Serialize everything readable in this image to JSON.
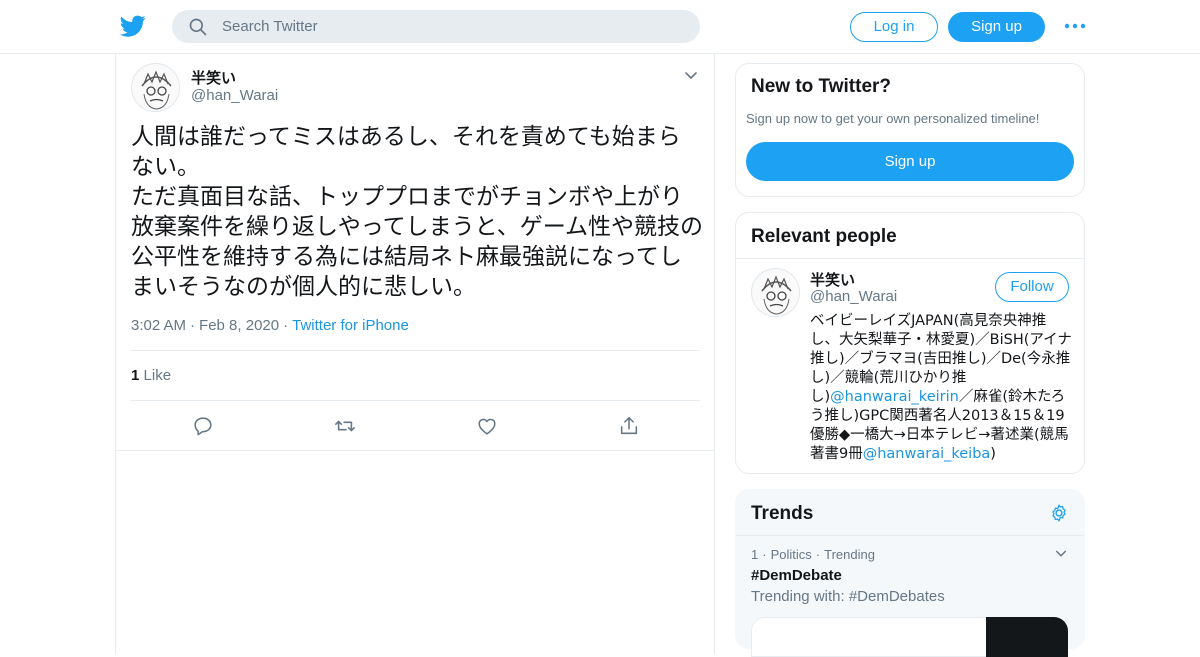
{
  "header": {
    "search_placeholder": "Search Twitter",
    "login_label": "Log in",
    "signup_label": "Sign up",
    "brand_color": "#1da1f2"
  },
  "tweet": {
    "display_name": "半笑い",
    "handle": "@han_Warai",
    "text": "人間は誰だってミスはあるし、それを責めても始まらない。\nただ真面目な話、トッププロまでがチョンボや上がり放棄案件を繰り返しやってしまうと、ゲーム性や競技の公平性を維持する為には結局ネト麻最強説になってしまいそうなのが個人的に悲しい。",
    "time": "3:02 AM",
    "date": "Feb 8, 2020",
    "source": "Twitter for iPhone",
    "like_count": "1",
    "like_label": "Like",
    "actions": [
      "reply-icon",
      "retweet-icon",
      "like-icon",
      "share-icon"
    ]
  },
  "sidebar": {
    "signup_card": {
      "title": "New to Twitter?",
      "subtitle": "Sign up now to get your own personalized timeline!",
      "button": "Sign up"
    },
    "relevant_people": {
      "title": "Relevant people",
      "person": {
        "display_name": "半笑い",
        "handle": "@han_Warai",
        "follow_label": "Follow",
        "bio_part1": "ベイビーレイズJAPAN(高見奈央神推し、大矢梨華子・林愛夏)／BiSH(アイナ推し)／ブラマヨ(吉田推し)／De(今永推し)／競輪(荒川ひかり推し)",
        "bio_link1": "@hanwarai_keirin",
        "bio_part2": "／麻雀(鈴木たろう推し)GPC関西著名人2013＆15＆19優勝◆一橋大→日本テレビ→著述業(競馬著書9冊",
        "bio_link2": "@hanwarai_keiba",
        "bio_part3": ")"
      }
    },
    "trends": {
      "title": "Trends",
      "items": [
        {
          "rank": "1",
          "category": "Politics",
          "status": "Trending",
          "name": "#DemDebate",
          "trending_with": "Trending with: #DemDebates"
        }
      ]
    }
  }
}
